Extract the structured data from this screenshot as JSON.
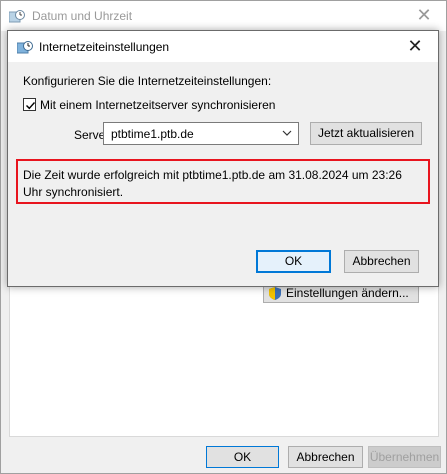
{
  "parent": {
    "title": "Datum und Uhrzeit",
    "settings_button": "Einstellungen ändern...",
    "ok_label": "OK",
    "cancel_label": "Abbrechen",
    "apply_label": "Übernehmen"
  },
  "dialog": {
    "title": "Internetzeiteinstellungen",
    "intro": "Konfigurieren Sie die Internetzeiteinstellungen:",
    "sync_checkbox_label": "Mit einem Internetzeitserver synchronisieren",
    "sync_checked": true,
    "server_label": "Server:",
    "server_value": "ptbtime1.ptb.de",
    "update_button": "Jetzt aktualisieren",
    "status_message": "Die Zeit wurde erfolgreich mit ptbtime1.ptb.de am 31.08.2024 um 23:26 Uhr synchronisiert.",
    "ok_label": "OK",
    "cancel_label": "Abbrechen"
  },
  "colors": {
    "highlight_border": "#e8141e",
    "focus_blue": "#0078d7"
  }
}
